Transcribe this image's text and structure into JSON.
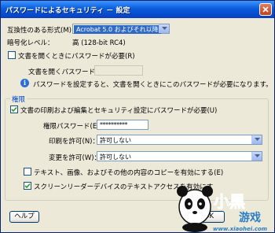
{
  "window": {
    "title": "パスワードによるセキュリティ － 設定"
  },
  "compat": {
    "label": "互換性のある形式(M)：",
    "value": "Acrobat 5.0 およびそれ以降"
  },
  "encryption": {
    "label": "暗号化レベル：",
    "value": "高 (128-bit RC4)"
  },
  "open_password": {
    "checkbox_label": "文書を開くときにパスワードが必要(R)",
    "checked": false,
    "field_label": "文書を開くパスワード(D)：",
    "value": ""
  },
  "info": {
    "icon": "info-icon",
    "text": "パスワードを設定すると、文書を開くときにこのパスワードが必要になります。"
  },
  "permissions": {
    "legend": "権限",
    "require_checkbox_label": "文書の印刷および編集とセキュリティ設定にパスワードが必要(U)",
    "require_checked": true,
    "password_label": "権限パスワード(E)：",
    "password_value": "**********",
    "print_label": "印刷を許可(N)：",
    "print_value": "許可しない",
    "change_label": "変更を許可(W)：",
    "change_value": "許可しない",
    "copy_label": "テキスト、画像、およびその他の内容のコピーを有効にする(E)",
    "copy_checked": false,
    "screenreader_label": "スクリーンリーダーデバイスのテキストアクセスを有効にす",
    "screenreader_checked": true
  },
  "buttons": {
    "help": "ヘルプ",
    "ok": "OK"
  },
  "watermark": {
    "logo_text": "小黑游戏",
    "url": "www.xiaohei.com"
  },
  "colors": {
    "titlebar": "#0a5ddc",
    "dialog_bg": "#ece9d8",
    "group_legend": "#0046d5",
    "watermark": "#2a7ec8"
  }
}
